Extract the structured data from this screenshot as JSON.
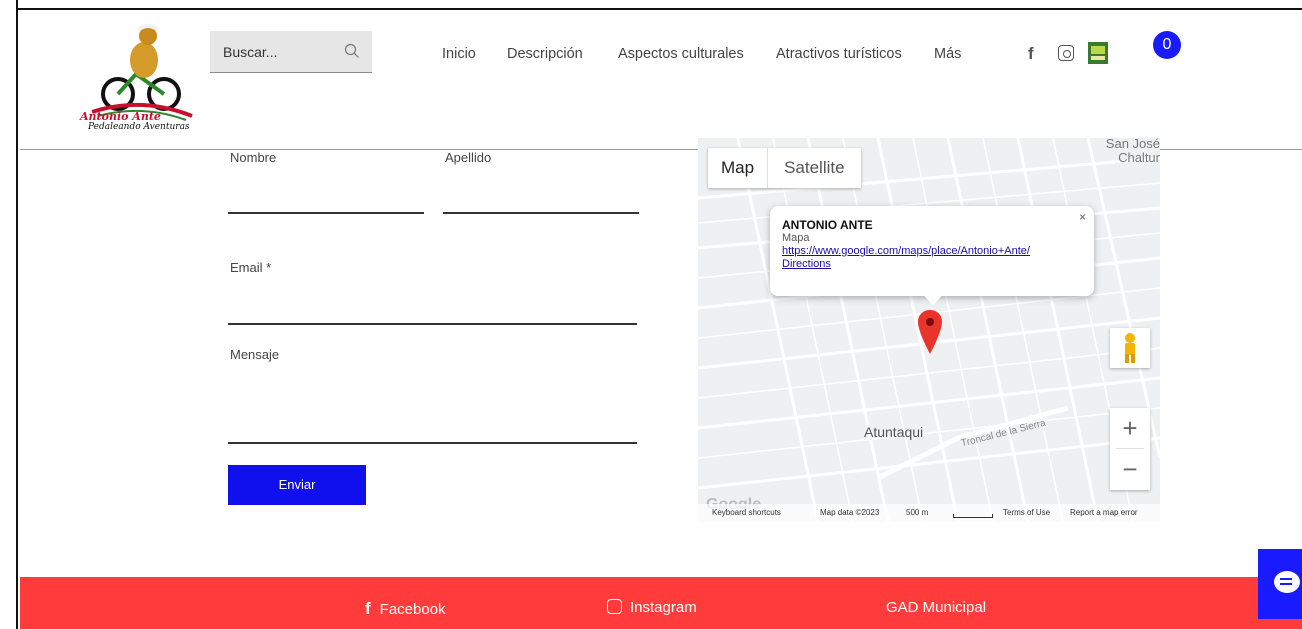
{
  "header": {
    "logo": {
      "line1": "Antonio Ante",
      "line2": "Pedaleando Aventuras"
    },
    "search": {
      "placeholder": "Buscar..."
    },
    "nav": [
      "Inicio",
      "Descripción",
      "Aspectos culturales",
      "Atractivos turísticos",
      "Más"
    ],
    "social_icons": [
      "facebook-icon",
      "instagram-icon",
      "gad-logo-icon"
    ],
    "cart_count": "0"
  },
  "form": {
    "first_name_label": "Nombre",
    "last_name_label": "Apellido",
    "email_label": "Email *",
    "message_label": "Mensaje",
    "submit_label": "Enviar"
  },
  "map": {
    "tab_map": "Map",
    "tab_satellite": "Satellite",
    "corner_text_line1": "San José",
    "corner_text_line2": "Chaltur",
    "popup": {
      "title": "ANTONIO ANTE",
      "subtitle": "Mapa",
      "link": "https://www.google.com/maps/place/Antonio+Ante/",
      "directions": "Directions",
      "close": "×"
    },
    "place_label": "Atuntaqui",
    "road_label": "Troncal de la Sierra",
    "google_logo": "Google",
    "footer": {
      "shortcuts": "Keyboard shortcuts",
      "data": "Map data ©2023",
      "scale": "500 m",
      "terms": "Terms of Use",
      "report": "Report a map error"
    },
    "zoom_in": "+",
    "zoom_out": "−"
  },
  "footer": {
    "facebook": "Facebook",
    "instagram": "Instagram",
    "gad": "GAD Municipal"
  },
  "colors": {
    "accent_blue": "#1010ee",
    "footer_red": "#ff3b3b",
    "logo_red": "#c8102e"
  }
}
